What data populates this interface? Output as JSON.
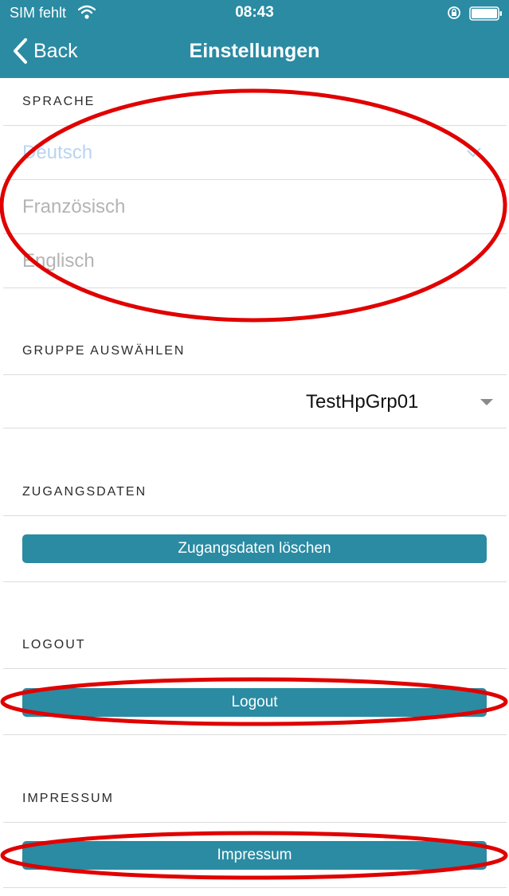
{
  "status_bar": {
    "carrier": "SIM fehlt",
    "time": "08:43"
  },
  "navbar": {
    "back_label": "Back",
    "title": "Einstellungen"
  },
  "language": {
    "header": "SPRACHE",
    "options": [
      "Deutsch",
      "Französisch",
      "Englisch"
    ],
    "selected": "Deutsch"
  },
  "group": {
    "header": "GRUPPE AUSWÄHLEN",
    "selected": "TestHpGrp01"
  },
  "credentials": {
    "header": "ZUGANGSDATEN",
    "button_label": "Zugangsdaten löschen"
  },
  "logout": {
    "header": "LOGOUT",
    "button_label": "Logout"
  },
  "imprint": {
    "header": "IMPRESSUM",
    "button_label": "Impressum"
  },
  "colors": {
    "accent": "#2a8ba3",
    "annotation": "#e00000",
    "selected_language": "#b8d4f2",
    "inactive_text": "#b4b4b4"
  }
}
